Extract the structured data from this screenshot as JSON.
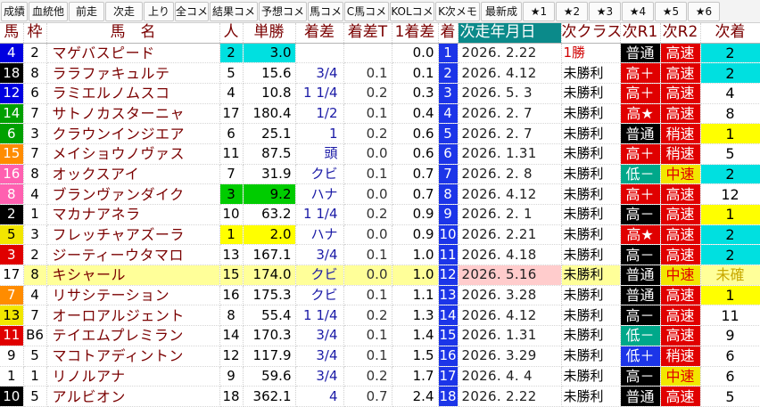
{
  "toolbar": [
    {
      "label": "成績"
    },
    {
      "label": "血統他"
    },
    {
      "label": "前走"
    },
    {
      "label": "次走"
    },
    {
      "label": "上り"
    },
    {
      "label": "全コメ"
    },
    {
      "label": "結果コメ"
    },
    {
      "label": "予想コメ"
    },
    {
      "label": "馬コメ"
    },
    {
      "label": "C馬コメ"
    },
    {
      "label": "KOLコメ"
    },
    {
      "label": "K次メモ"
    },
    {
      "label": "最新成"
    },
    {
      "label": "★1"
    },
    {
      "label": "★2"
    },
    {
      "label": "★3"
    },
    {
      "label": "★4"
    },
    {
      "label": "★5"
    },
    {
      "label": "★6"
    }
  ],
  "headers": {
    "ban": "馬",
    "waku": "枠",
    "name": "馬　名",
    "pop": "人",
    "odds": "単勝",
    "diff": "着差",
    "diff_t": "着差T",
    "cum": "1着差",
    "order": "着",
    "next_date": "次走年月日",
    "next_class": "次クラス",
    "r1": "次R1",
    "r2": "次R2",
    "next": "次着"
  },
  "colors": {
    "horse_num_bg": [
      "#ffffff",
      "#000000",
      "#e00000",
      "#0000e0",
      "#f2e600",
      "#00a000",
      "#ff8c00",
      "#ff60b0"
    ],
    "rating_bg": {
      "普通": "#000000",
      "高速": "#e00000",
      "高＋": "#e00000",
      "高★": "#e00000",
      "高－": "#000000",
      "低－": "#00a88a",
      "低＋": "#1c35e8",
      "稍速": "#e00000",
      "中速": "#f2e600"
    },
    "rating_fg": {
      "普通": "#ffffff",
      "高速": "#ffffff",
      "高＋": "#ffffff",
      "高★": "#ffffff",
      "高－": "#ffffff",
      "低－": "#ffffff",
      "低＋": "#ffffff",
      "稍速": "#ffffff",
      "中速": "#e00000"
    },
    "next_bg": {
      "1": "#ffff00",
      "2": "#00e0e0"
    },
    "highlight_row": "#ffff99",
    "odds_first_bg": "#ffff00",
    "odds_second_bg": "#00e0e0",
    "odds_third_bg": "#00cc00",
    "next_date_highlight": "#ffcccc"
  },
  "rows": [
    {
      "ban": "4",
      "waku": "2",
      "name": "マゲバスピード",
      "pop": "2",
      "odds": "3.0",
      "diff": "",
      "diff_t": "",
      "cum": "0.0",
      "order": "1",
      "next_date": "2026. 2.22",
      "next_class": "1勝",
      "r1": "普通",
      "r2": "高速",
      "next": "2",
      "odds_rank": 2
    },
    {
      "ban": "18",
      "waku": "8",
      "name": "ララファキュルテ",
      "pop": "5",
      "odds": "15.6",
      "diff": "3/4",
      "diff_t": "0.1",
      "cum": "0.1",
      "order": "2",
      "next_date": "2026. 4.12",
      "next_class": "未勝利",
      "r1": "高＋",
      "r2": "高速",
      "next": "2"
    },
    {
      "ban": "12",
      "waku": "6",
      "name": "ラミエルノムスコ",
      "pop": "4",
      "odds": "10.8",
      "diff": "1 1/4",
      "diff_t": "0.2",
      "cum": "0.3",
      "order": "3",
      "next_date": "2026. 5. 3",
      "next_class": "未勝利",
      "r1": "高＋",
      "r2": "高速",
      "next": "4"
    },
    {
      "ban": "14",
      "waku": "7",
      "name": "サトノカスターニャ",
      "pop": "17",
      "odds": "180.4",
      "diff": "1/2",
      "diff_t": "0.1",
      "cum": "0.4",
      "order": "4",
      "next_date": "2026. 2. 7",
      "next_class": "未勝利",
      "r1": "高★",
      "r2": "高速",
      "next": "8"
    },
    {
      "ban": "6",
      "waku": "3",
      "name": "クラウンインジエア",
      "pop": "6",
      "odds": "25.1",
      "diff": "1",
      "diff_t": "0.2",
      "cum": "0.6",
      "order": "5",
      "next_date": "2026. 2. 7",
      "next_class": "未勝利",
      "r1": "普通",
      "r2": "稍速",
      "next": "1"
    },
    {
      "ban": "15",
      "waku": "7",
      "name": "メイショウノヴァス",
      "pop": "11",
      "odds": "87.5",
      "diff": "頭",
      "diff_t": "0.0",
      "cum": "0.6",
      "order": "6",
      "next_date": "2026. 1.31",
      "next_class": "未勝利",
      "r1": "高＋",
      "r2": "稍速",
      "next": "5"
    },
    {
      "ban": "16",
      "waku": "8",
      "name": "オックスアイ",
      "pop": "7",
      "odds": "31.9",
      "diff": "クビ",
      "diff_t": "0.1",
      "cum": "0.7",
      "order": "7",
      "next_date": "2026. 2. 8",
      "next_class": "未勝利",
      "r1": "低－",
      "r2": "中速",
      "next": "2"
    },
    {
      "ban": "8",
      "waku": "4",
      "name": "ブランヴァンダイク",
      "pop": "3",
      "odds": "9.2",
      "diff": "ハナ",
      "diff_t": "0.0",
      "cum": "0.7",
      "order": "8",
      "next_date": "2026. 4.12",
      "next_class": "未勝利",
      "r1": "高＋",
      "r2": "高速",
      "next": "12",
      "odds_rank": 3
    },
    {
      "ban": "2",
      "waku": "1",
      "name": "マカナアネラ",
      "pop": "10",
      "odds": "63.2",
      "diff": "1 1/4",
      "diff_t": "0.2",
      "cum": "0.9",
      "order": "9",
      "next_date": "2026. 2. 1",
      "next_class": "未勝利",
      "r1": "高－",
      "r2": "高速",
      "next": "1"
    },
    {
      "ban": "5",
      "waku": "3",
      "name": "フレッチャアズーラ",
      "pop": "1",
      "odds": "2.0",
      "diff": "ハナ",
      "diff_t": "0.0",
      "cum": "0.9",
      "order": "10",
      "next_date": "2026. 2.21",
      "next_class": "未勝利",
      "r1": "高★",
      "r2": "高速",
      "next": "2",
      "odds_rank": 1
    },
    {
      "ban": "3",
      "waku": "2",
      "name": "ジーティーウタマロ",
      "pop": "13",
      "odds": "167.1",
      "diff": "3/4",
      "diff_t": "0.1",
      "cum": "1.0",
      "order": "11",
      "next_date": "2026. 4.18",
      "next_class": "未勝利",
      "r1": "高－",
      "r2": "高速",
      "next": "2"
    },
    {
      "ban": "17",
      "waku": "8",
      "name": "キシャール",
      "pop": "15",
      "odds": "174.0",
      "diff": "クビ",
      "diff_t": "0.0",
      "cum": "1.0",
      "order": "12",
      "next_date": "2026. 5.16",
      "next_class": "未勝利",
      "r1": "普通",
      "r2": "中速",
      "next": "未確",
      "highlight": true
    },
    {
      "ban": "7",
      "waku": "4",
      "name": "リサシテーション",
      "pop": "16",
      "odds": "175.3",
      "diff": "クビ",
      "diff_t": "0.1",
      "cum": "1.1",
      "order": "13",
      "next_date": "2026. 3.28",
      "next_class": "未勝利",
      "r1": "普通",
      "r2": "高速",
      "next": "1"
    },
    {
      "ban": "13",
      "waku": "7",
      "name": "オーロアルジェント",
      "pop": "8",
      "odds": "55.4",
      "diff": "1 1/4",
      "diff_t": "0.2",
      "cum": "1.3",
      "order": "14",
      "next_date": "2026. 4.12",
      "next_class": "未勝利",
      "r1": "高－",
      "r2": "高速",
      "next": "11"
    },
    {
      "ban": "11",
      "waku": "B6",
      "name": "テイエムプレミラン",
      "pop": "14",
      "odds": "170.3",
      "diff": "3/4",
      "diff_t": "0.1",
      "cum": "1.4",
      "order": "15",
      "next_date": "2026. 1.31",
      "next_class": "未勝利",
      "r1": "低－",
      "r2": "高速",
      "next": "9"
    },
    {
      "ban": "9",
      "waku": "5",
      "name": "マコトアディントン",
      "pop": "12",
      "odds": "117.9",
      "diff": "3/4",
      "diff_t": "0.1",
      "cum": "1.5",
      "order": "16",
      "next_date": "2026. 3.29",
      "next_class": "未勝利",
      "r1": "低＋",
      "r2": "稍速",
      "next": "6"
    },
    {
      "ban": "1",
      "waku": "1",
      "name": "リノルアナ",
      "pop": "9",
      "odds": "59.6",
      "diff": "3/4",
      "diff_t": "0.2",
      "cum": "1.7",
      "order": "17",
      "next_date": "2026. 4. 4",
      "next_class": "未勝利",
      "r1": "高－",
      "r2": "中速",
      "next": "6"
    },
    {
      "ban": "10",
      "waku": "5",
      "name": "アルビオン",
      "pop": "18",
      "odds": "362.1",
      "diff": "4",
      "diff_t": "0.7",
      "cum": "2.4",
      "order": "18",
      "next_date": "2026. 2.22",
      "next_class": "未勝利",
      "r1": "普通",
      "r2": "高速",
      "next": "5"
    }
  ]
}
